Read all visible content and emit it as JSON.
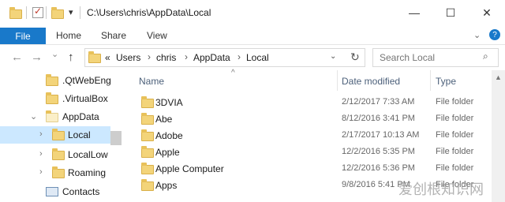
{
  "window": {
    "title": "C:\\Users\\chris\\AppData\\Local",
    "min_glyph": "—",
    "max_glyph": "☐",
    "close_glyph": "✕",
    "qa_dropdown_glyph": "▾"
  },
  "ribbon": {
    "tabs": [
      "File",
      "Home",
      "Share",
      "View"
    ],
    "expand_glyph": "⌄",
    "help_glyph": "?"
  },
  "nav": {
    "back_glyph": "←",
    "forward_glyph": "→",
    "recent_glyph": "⌄",
    "up_glyph": "↑",
    "address": {
      "overflow": "«",
      "crumbs": [
        "Users",
        "chris",
        "AppData",
        "Local"
      ],
      "sep_glyph": "›",
      "dropdown_glyph": "⌄",
      "refresh_glyph": "↻"
    },
    "search_placeholder": "Search Local",
    "search_glyph": "⌕"
  },
  "navpane": {
    "items": [
      {
        "label": ".QtWebEngi",
        "arrow": "",
        "icon": "folder-icon"
      },
      {
        "label": ".VirtualBox",
        "arrow": "",
        "icon": "folder-icon"
      },
      {
        "label": "AppData",
        "arrow": "⌄",
        "icon": "folder-icon"
      },
      {
        "label": "Local",
        "arrow": "›",
        "icon": "folder-icon",
        "selected": true
      },
      {
        "label": "LocalLow",
        "arrow": "›",
        "icon": "folder-icon"
      },
      {
        "label": "Roaming",
        "arrow": "›",
        "icon": "folder-icon"
      },
      {
        "label": "Contacts",
        "arrow": "",
        "icon": "contacts-icon"
      }
    ]
  },
  "content": {
    "columns": {
      "name": "Name",
      "date": "Date modified",
      "type": "Type"
    },
    "sort_glyph": "^",
    "rows": [
      {
        "name": "3DVIA",
        "date": "2/12/2017 7:33 AM",
        "type": "File folder"
      },
      {
        "name": "Abe",
        "date": "8/12/2016 3:41 PM",
        "type": "File folder"
      },
      {
        "name": "Adobe",
        "date": "2/17/2017 10:13 AM",
        "type": "File folder"
      },
      {
        "name": "Apple",
        "date": "12/2/2016 5:35 PM",
        "type": "File folder"
      },
      {
        "name": "Apple Computer",
        "date": "12/2/2016 5:36 PM",
        "type": "File folder"
      },
      {
        "name": "Apps",
        "date": "9/8/2016 5:41 PM",
        "type": "File folder"
      }
    ]
  },
  "scroll_up_glyph": "▲",
  "watermark": "爱创根知识网",
  "colors": {
    "accent": "#1979ca",
    "selection": "#cce8ff",
    "folder": "#f3d47a"
  }
}
